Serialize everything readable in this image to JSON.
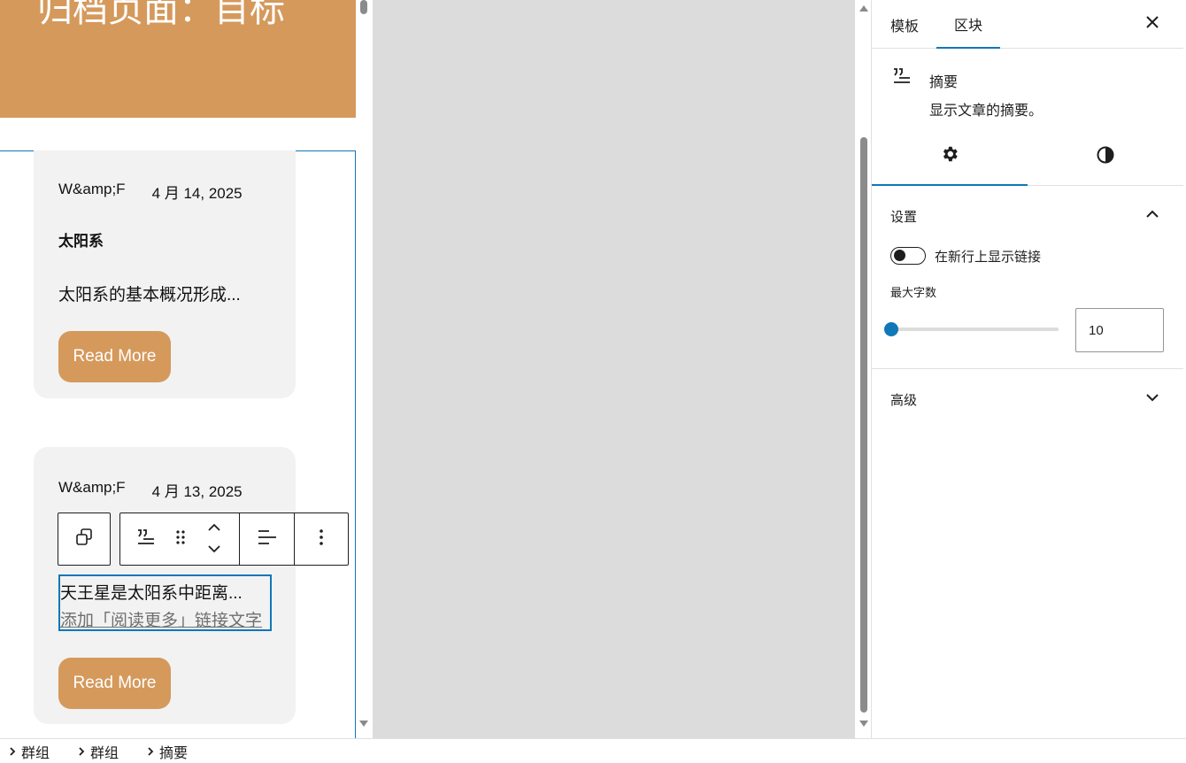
{
  "canvas": {
    "hero_title": "归档页面：目标",
    "cards": [
      {
        "author": "W&amp;F",
        "date": "4 月 14, 2025",
        "title": "太阳系",
        "excerpt": "太阳系的基本概况形成...",
        "read_more": "Read More"
      },
      {
        "author": "W&amp;F",
        "date": "4 月 13, 2025",
        "excerpt": "天王星是太阳系中距离...",
        "more_placeholder": "添加「阅读更多」链接文字",
        "read_more": "Read More"
      }
    ]
  },
  "toolbar": {
    "icons": [
      "transform-icon",
      "excerpt-block-icon",
      "drag-handle-icon",
      "move-up-icon",
      "move-down-icon",
      "align-icon",
      "more-options-icon"
    ]
  },
  "sidebar": {
    "tabs": [
      "模板",
      "区块"
    ],
    "active_tab": "区块",
    "block": {
      "name": "摘要",
      "description": "显示文章的摘要。"
    },
    "settings_panel": {
      "title": "设置",
      "toggle_label": "在新行上显示链接",
      "toggle_on": false,
      "range_label": "最大字数",
      "max_words": "10"
    },
    "advanced_panel": {
      "title": "高级"
    }
  },
  "breadcrumb": [
    "群组",
    "群组",
    "摘要"
  ],
  "colors": {
    "accent": "#1077b8",
    "brand": "#d5995c",
    "card_bg": "#f2f2f2",
    "gap_bg": "#dcdcdc"
  }
}
